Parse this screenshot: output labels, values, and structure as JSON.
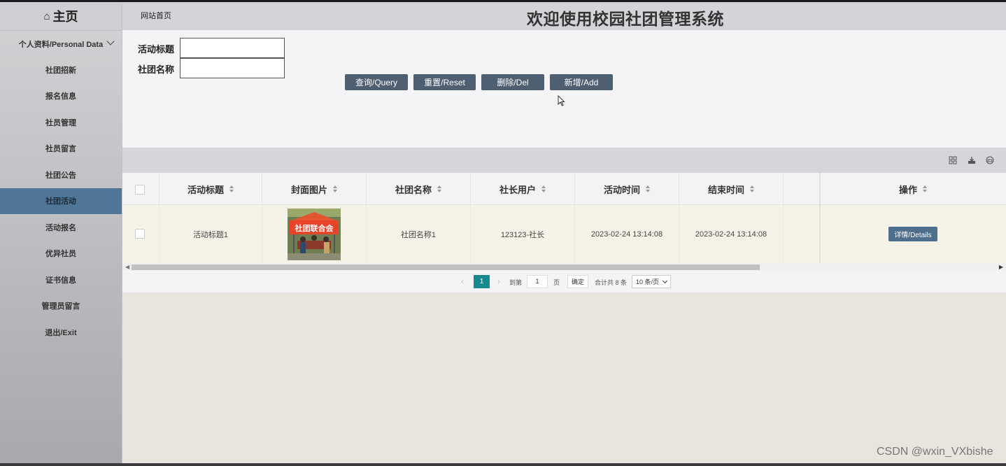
{
  "sidebar": {
    "home": "主页",
    "group": "个人资料/Personal Data",
    "items": [
      {
        "label": "社团招新",
        "active": false
      },
      {
        "label": "报名信息",
        "active": false
      },
      {
        "label": "社员管理",
        "active": false
      },
      {
        "label": "社员留言",
        "active": false
      },
      {
        "label": "社团公告",
        "active": false
      },
      {
        "label": "社团活动",
        "active": true
      },
      {
        "label": "活动报名",
        "active": false
      },
      {
        "label": "优异社员",
        "active": false
      },
      {
        "label": "证书信息",
        "active": false
      },
      {
        "label": "管理员留言",
        "active": false
      },
      {
        "label": "退出/Exit",
        "active": false
      }
    ]
  },
  "header": {
    "breadcrumb": "网站首页",
    "title": "欢迎使用校园社团管理系统"
  },
  "search": {
    "fields": [
      {
        "label": "活动标题",
        "value": ""
      },
      {
        "label": "社团名称",
        "value": ""
      }
    ],
    "buttons": {
      "query": "查询/Query",
      "reset": "重置/Reset",
      "delete": "删除/Del",
      "add": "新增/Add"
    }
  },
  "toolbar": {
    "icons": [
      "columns-icon",
      "export-icon",
      "print-icon"
    ]
  },
  "table": {
    "columns": [
      "活动标题",
      "封面图片",
      "社团名称",
      "社长用户",
      "活动时间",
      "结束时间",
      "操作"
    ],
    "rows": [
      {
        "title": "活动标题1",
        "cover_text": "社团联合会",
        "club": "社团名称1",
        "leader": "123123-社长",
        "start": "2023-02-24 13:14:08",
        "end": "2023-02-24 13:14:08",
        "action": "详情/Details"
      }
    ]
  },
  "pager": {
    "current": "1",
    "goto_label": "到第",
    "goto_value": "1",
    "page_unit": "页",
    "confirm": "确定",
    "total": "合计共 8 条",
    "page_size": "10 条/页"
  },
  "watermark": "CSDN @wxin_VXbishe",
  "colors": {
    "sidebar_active": "#4f7597",
    "button": "#4e5f72",
    "pager_active": "#158b8f",
    "details_button": "#4e6e8e"
  }
}
